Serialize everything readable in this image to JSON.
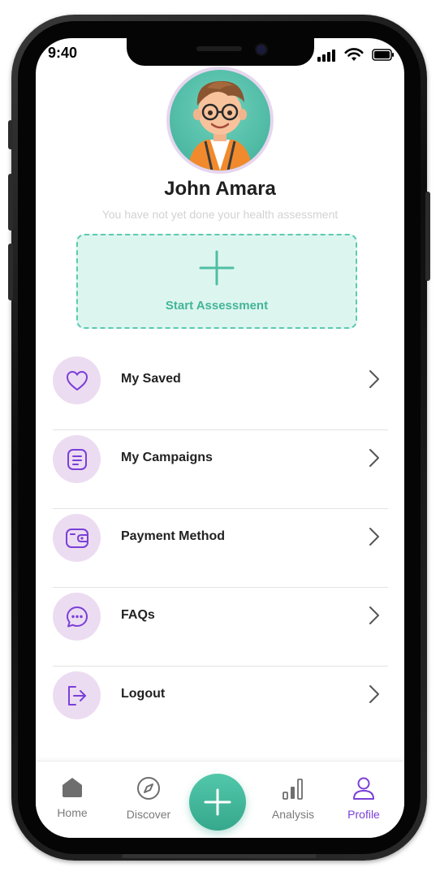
{
  "status_bar": {
    "time": "9:40"
  },
  "profile": {
    "name": "John Amara",
    "assessment_note": "You have not yet done your health assessment"
  },
  "assessment": {
    "button_label": "Start Assessment"
  },
  "menu": {
    "items": [
      {
        "label": "My Saved",
        "icon": "heart-icon"
      },
      {
        "label": "My Campaigns",
        "icon": "document-icon"
      },
      {
        "label": "Payment Method",
        "icon": "wallet-icon"
      },
      {
        "label": "FAQs",
        "icon": "chat-bubble-icon"
      },
      {
        "label": "Logout",
        "icon": "logout-icon"
      }
    ]
  },
  "bottom_nav": {
    "items": [
      {
        "label": "Home",
        "icon": "home-icon"
      },
      {
        "label": "Discover",
        "icon": "compass-icon"
      },
      {
        "label": "Analysis",
        "icon": "bar-chart-icon"
      },
      {
        "label": "Profile",
        "icon": "user-icon",
        "active": true
      }
    ],
    "center_action_icon": "plus-icon"
  },
  "colors": {
    "accent_green": "#43b598",
    "accent_purple": "#7a3fd8",
    "icon_bg": "#ecdcf1",
    "assessment_bg": "#ddf5ef"
  }
}
